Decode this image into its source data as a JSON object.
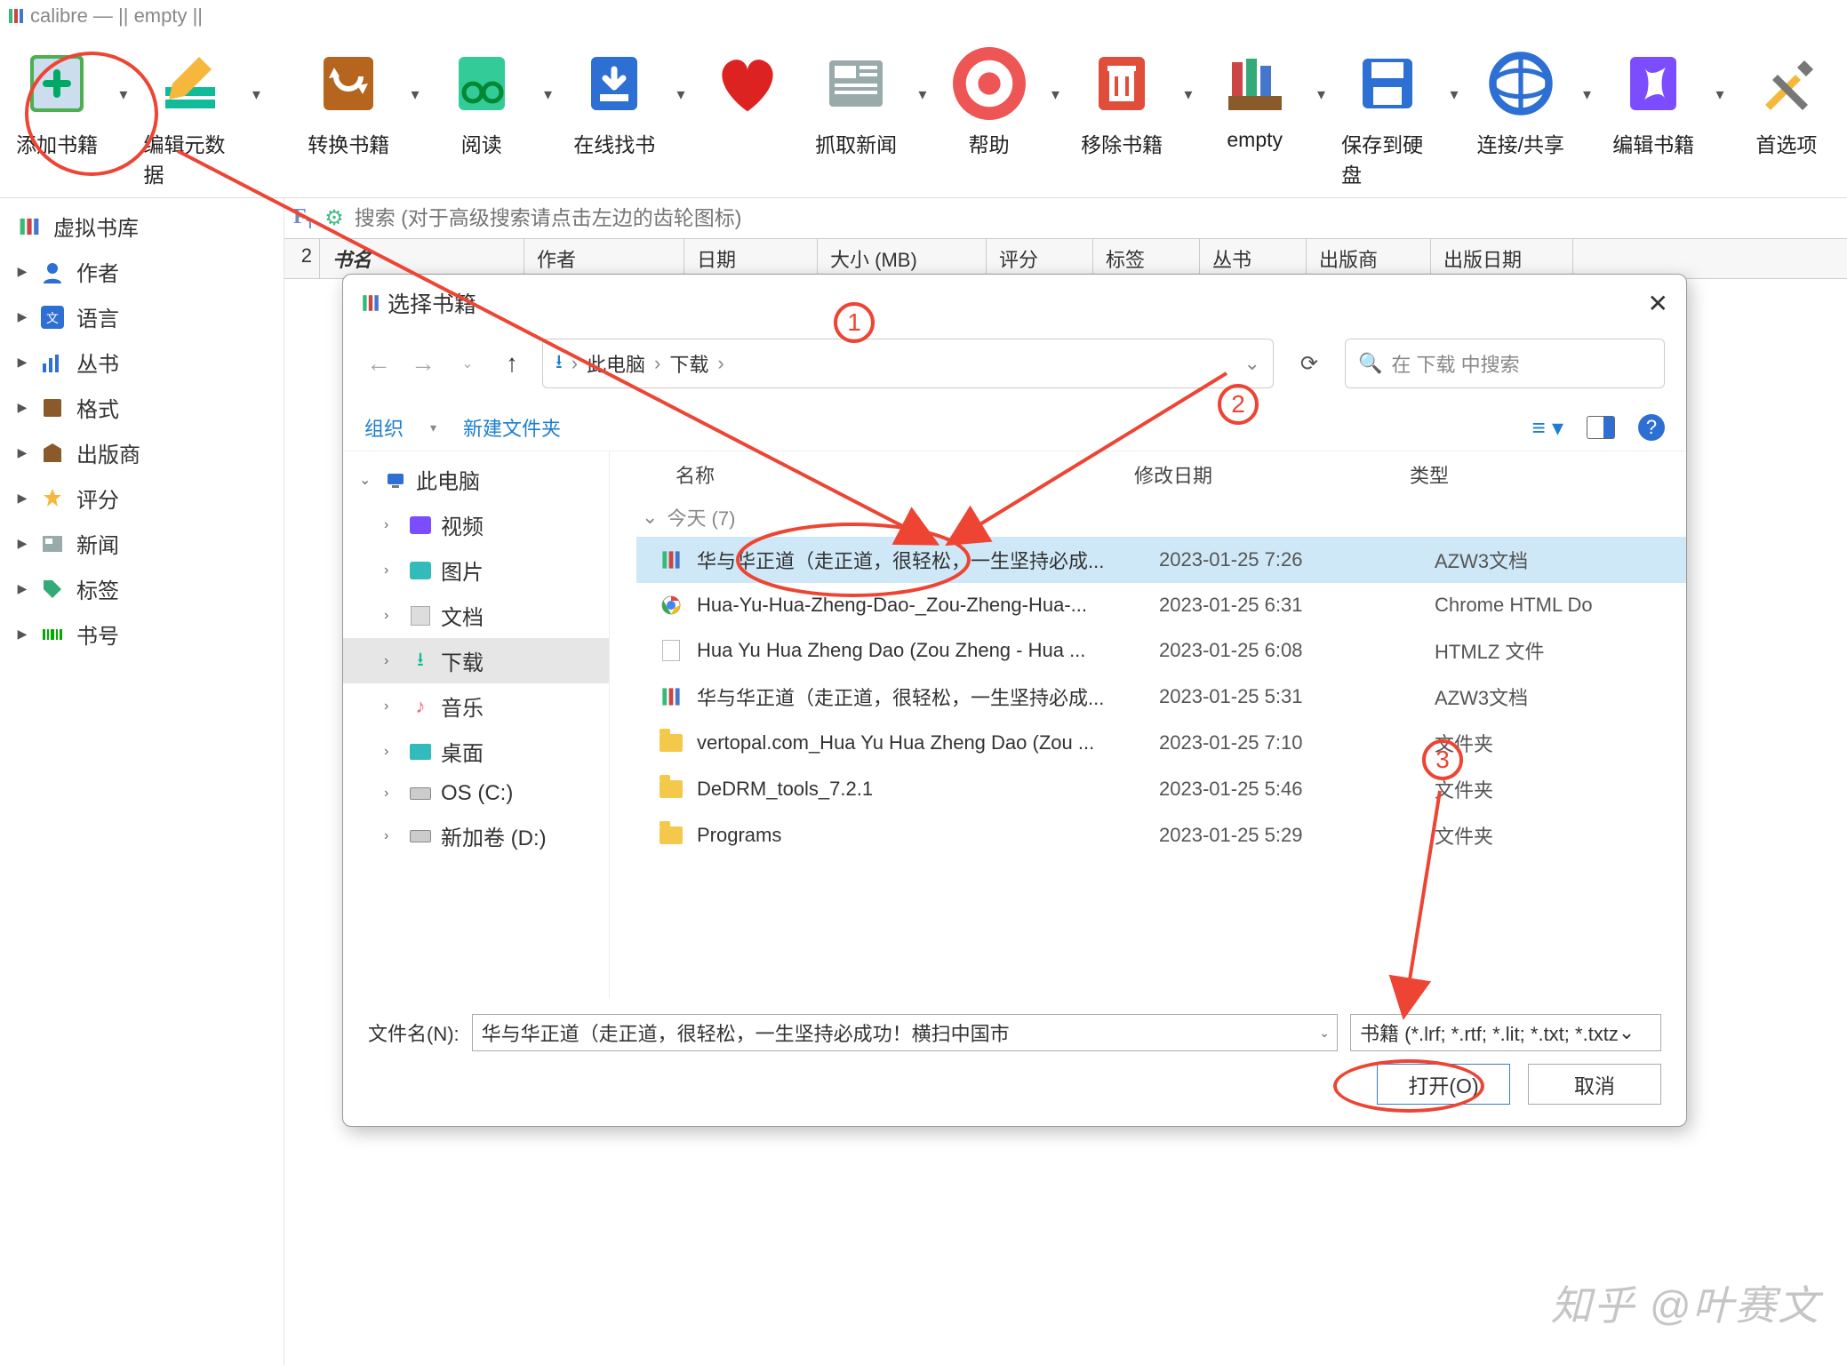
{
  "titlebar": {
    "text": "calibre — || empty ||"
  },
  "toolbar": {
    "items": [
      {
        "label": "添加书籍",
        "icon": "add-book-icon",
        "drop": true
      },
      {
        "label": "编辑元数据",
        "icon": "edit-metadata-icon",
        "drop": true
      },
      {
        "label": "转换书籍",
        "icon": "convert-book-icon",
        "drop": true
      },
      {
        "label": "阅读",
        "icon": "read-icon",
        "drop": true
      },
      {
        "label": "在线找书",
        "icon": "get-books-icon",
        "drop": true
      },
      {
        "label": "",
        "icon": "heart-icon",
        "drop": false
      },
      {
        "label": "抓取新闻",
        "icon": "fetch-news-icon",
        "drop": true
      },
      {
        "label": "帮助",
        "icon": "help-icon",
        "drop": true
      },
      {
        "label": "移除书籍",
        "icon": "remove-book-icon",
        "drop": true
      },
      {
        "label": "empty",
        "icon": "library-icon",
        "drop": true
      },
      {
        "label": "保存到硬盘",
        "icon": "save-disk-icon",
        "drop": true
      },
      {
        "label": "连接/共享",
        "icon": "connect-share-icon",
        "drop": true
      },
      {
        "label": "编辑书籍",
        "icon": "edit-book-icon",
        "drop": true
      },
      {
        "label": "首选项",
        "icon": "preferences-icon",
        "drop": false
      }
    ]
  },
  "sidebar": {
    "top": "虚拟书库",
    "items": [
      {
        "label": "作者",
        "icon": "author-icon"
      },
      {
        "label": "语言",
        "icon": "language-icon"
      },
      {
        "label": "丛书",
        "icon": "series-icon"
      },
      {
        "label": "格式",
        "icon": "format-icon"
      },
      {
        "label": "出版商",
        "icon": "publisher-icon"
      },
      {
        "label": "评分",
        "icon": "rating-icon"
      },
      {
        "label": "新闻",
        "icon": "news-icon"
      },
      {
        "label": "标签",
        "icon": "tag-icon"
      },
      {
        "label": "书号",
        "icon": "id-icon"
      }
    ]
  },
  "search": {
    "placeholder": "搜索 (对于高级搜索请点击左边的齿轮图标)"
  },
  "grid": {
    "rownum": "2",
    "columns": [
      "书名",
      "作者",
      "日期",
      "大小 (MB)",
      "评分",
      "标签",
      "丛书",
      "出版商",
      "出版日期"
    ]
  },
  "dialog": {
    "title": "选择书籍",
    "path_parts": [
      "此电脑",
      "下载"
    ],
    "search_placeholder": "在 下载 中搜索",
    "organize": "组织",
    "newfolder": "新建文件夹",
    "tree": [
      {
        "label": "此电脑",
        "icon": "pc-icon",
        "level": 0,
        "expanded": true
      },
      {
        "label": "视频",
        "icon": "video-icon",
        "level": 1
      },
      {
        "label": "图片",
        "icon": "pictures-icon",
        "level": 1
      },
      {
        "label": "文档",
        "icon": "documents-icon",
        "level": 1
      },
      {
        "label": "下载",
        "icon": "downloads-icon",
        "level": 1,
        "selected": true
      },
      {
        "label": "音乐",
        "icon": "music-icon",
        "level": 1
      },
      {
        "label": "桌面",
        "icon": "desktop-icon",
        "level": 1
      },
      {
        "label": "OS (C:)",
        "icon": "drive-icon",
        "level": 1
      },
      {
        "label": "新加卷 (D:)",
        "icon": "drive-icon",
        "level": 1
      }
    ],
    "file_columns": {
      "name": "名称",
      "date": "修改日期",
      "type": "类型"
    },
    "group": "今天 (7)",
    "files": [
      {
        "name": "华与华正道（走正道，很轻松，一生坚持必成...",
        "date": "2023-01-25 7:26",
        "type": "AZW3文档",
        "icon": "calibre-file-icon",
        "selected": true
      },
      {
        "name": "Hua-Yu-Hua-Zheng-Dao-_Zou-Zheng-Hua-...",
        "date": "2023-01-25 6:31",
        "type": "Chrome HTML Do",
        "icon": "chrome-icon"
      },
      {
        "name": "Hua Yu Hua Zheng Dao (Zou Zheng - Hua ...",
        "date": "2023-01-25 6:08",
        "type": "HTMLZ 文件",
        "icon": "file-icon"
      },
      {
        "name": "华与华正道（走正道，很轻松，一生坚持必成...",
        "date": "2023-01-25 5:31",
        "type": "AZW3文档",
        "icon": "calibre-file-icon"
      },
      {
        "name": "vertopal.com_Hua Yu Hua Zheng Dao (Zou ...",
        "date": "2023-01-25 7:10",
        "type": "文件夹",
        "icon": "folder-icon"
      },
      {
        "name": "DeDRM_tools_7.2.1",
        "date": "2023-01-25 5:46",
        "type": "文件夹",
        "icon": "folder-icon"
      },
      {
        "name": "Programs",
        "date": "2023-01-25 5:29",
        "type": "文件夹",
        "icon": "folder-icon"
      }
    ],
    "filename_label": "文件名(N):",
    "filename_value": "华与华正道（走正道，很轻松，一生坚持必成功！横扫中国市",
    "filter_value": "书籍 (*.lrf; *.rtf; *.lit; *.txt; *.txtz",
    "open_btn": "打开(O)",
    "cancel_btn": "取消"
  },
  "annotations": {
    "n1": "1",
    "n2": "2",
    "n3": "3"
  },
  "watermark": "知乎 @叶赛文"
}
